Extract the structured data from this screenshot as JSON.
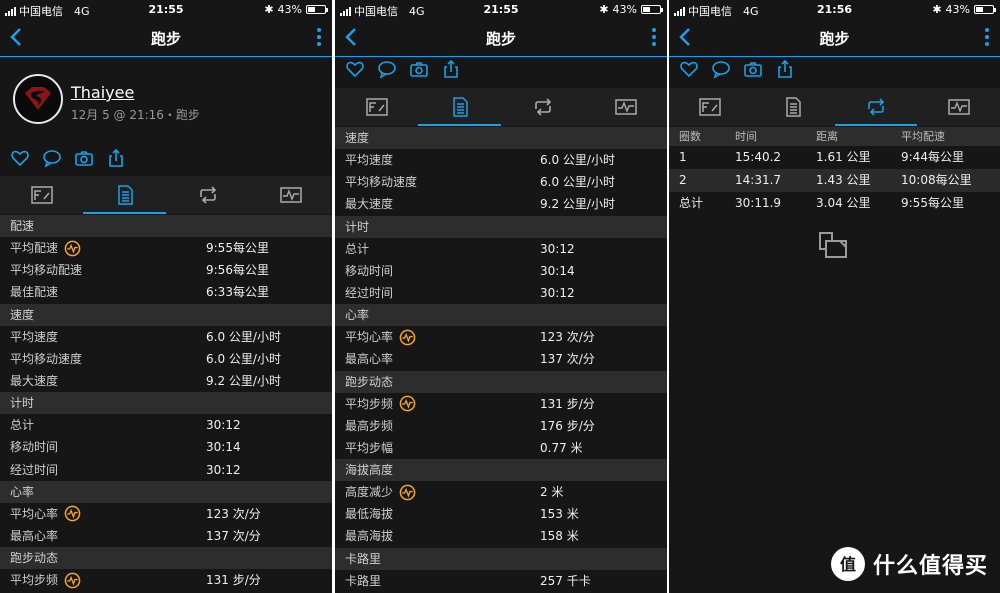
{
  "status": {
    "carrier": "中国电信",
    "network": "4G",
    "battery": "43%",
    "times": [
      "21:55",
      "21:55",
      "21:56"
    ]
  },
  "nav": {
    "title": "跑步"
  },
  "profile": {
    "username": "Thaiyee",
    "meta": "12月 5 @ 21:16・跑步"
  },
  "icons": {
    "accent": "#1aa0e8",
    "badge": "#f5a623",
    "actions": [
      "heart-icon",
      "comment-icon",
      "camera-icon",
      "share-icon"
    ],
    "tabs": [
      "overview-icon",
      "stats-icon",
      "laps-icon",
      "charts-icon"
    ]
  },
  "panel1": {
    "sections": [
      {
        "title": "配速",
        "rows": [
          {
            "label": "平均配速",
            "value": "9:55每公里",
            "badge": true
          },
          {
            "label": "平均移动配速",
            "value": "9:56每公里"
          },
          {
            "label": "最佳配速",
            "value": "6:33每公里"
          }
        ]
      },
      {
        "title": "速度",
        "rows": [
          {
            "label": "平均速度",
            "value": "6.0 公里/小时"
          },
          {
            "label": "平均移动速度",
            "value": "6.0 公里/小时"
          },
          {
            "label": "最大速度",
            "value": "9.2 公里/小时"
          }
        ]
      },
      {
        "title": "计时",
        "rows": [
          {
            "label": "总计",
            "value": "30:12"
          },
          {
            "label": "移动时间",
            "value": "30:14"
          },
          {
            "label": "经过时间",
            "value": "30:12"
          }
        ]
      },
      {
        "title": "心率",
        "rows": [
          {
            "label": "平均心率",
            "value": "123 次/分",
            "badge": true
          },
          {
            "label": "最高心率",
            "value": "137 次/分"
          }
        ]
      },
      {
        "title": "跑步动态",
        "rows": [
          {
            "label": "平均步频",
            "value": "131 步/分",
            "badge": true
          }
        ]
      }
    ]
  },
  "panel2": {
    "sections": [
      {
        "title": "速度",
        "rows": [
          {
            "label": "平均速度",
            "value": "6.0 公里/小时"
          },
          {
            "label": "平均移动速度",
            "value": "6.0 公里/小时"
          },
          {
            "label": "最大速度",
            "value": "9.2 公里/小时"
          }
        ]
      },
      {
        "title": "计时",
        "rows": [
          {
            "label": "总计",
            "value": "30:12"
          },
          {
            "label": "移动时间",
            "value": "30:14"
          },
          {
            "label": "经过时间",
            "value": "30:12"
          }
        ]
      },
      {
        "title": "心率",
        "rows": [
          {
            "label": "平均心率",
            "value": "123 次/分",
            "badge": true
          },
          {
            "label": "最高心率",
            "value": "137 次/分"
          }
        ]
      },
      {
        "title": "跑步动态",
        "rows": [
          {
            "label": "平均步频",
            "value": "131 步/分",
            "badge": true
          },
          {
            "label": "最高步频",
            "value": "176 步/分"
          },
          {
            "label": "平均步幅",
            "value": "0.77 米"
          }
        ]
      },
      {
        "title": "海拔高度",
        "rows": [
          {
            "label": "高度减少",
            "value": "2 米",
            "badge": true
          },
          {
            "label": "最低海拔",
            "value": "153 米"
          },
          {
            "label": "最高海拔",
            "value": "158 米"
          }
        ]
      },
      {
        "title": "卡路里",
        "rows": [
          {
            "label": "卡路里",
            "value": "257 千卡"
          }
        ]
      }
    ]
  },
  "panel3": {
    "headers": [
      "圈数",
      "时间",
      "距离",
      "平均配速"
    ],
    "laps": [
      [
        "1",
        "15:40.2",
        "1.61 公里",
        "9:44每公里"
      ],
      [
        "2",
        "14:31.7",
        "1.43 公里",
        "10:08每公里"
      ],
      [
        "总计",
        "30:11.9",
        "3.04 公里",
        "9:55每公里"
      ]
    ]
  },
  "watermark": {
    "text": "什么值得买",
    "logo": "值"
  }
}
